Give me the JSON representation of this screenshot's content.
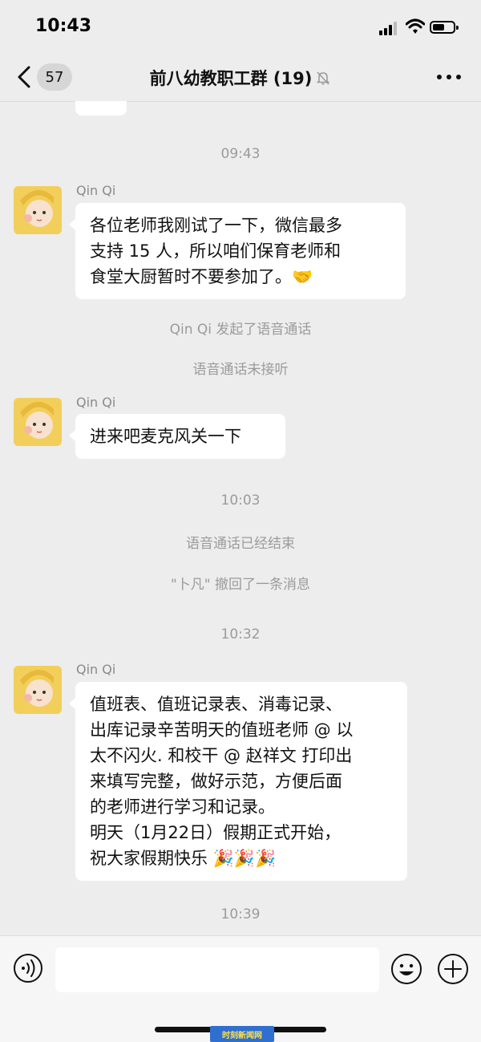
{
  "status_bar": {
    "time": "10:43"
  },
  "nav": {
    "back_count": "57",
    "title": "前八幼教职工群 (19)",
    "mute_icon": "bell-slash-icon",
    "more_icon": "ellipsis-icon"
  },
  "messages": {
    "time_1": "09:43",
    "sender_1": "Qin Qi",
    "bubble_1": [
      "各位老师我刚试了一下，微信最多",
      "支持 15 人，所以咱们保育老师和",
      "食堂大厨暂时不要参加了。🤝"
    ],
    "system_1": "Qin Qi 发起了语音通话",
    "system_2": "语音通话未接听",
    "sender_2": "Qin Qi",
    "bubble_2": "进来吧麦克风关一下",
    "time_2": "10:03",
    "system_3": "语音通话已经结束",
    "system_4": "\"卜凡\" 撤回了一条消息",
    "time_3": "10:32",
    "sender_3": "Qin Qi",
    "bubble_3": [
      "值班表、值班记录表、消毒记录、",
      "出库记录辛苦明天的值班老师 @ 以",
      "太不闪火. 和校干 @ 赵祥文 打印出",
      "来填写完整，做好示范，方便后面",
      "的老师进行学习和记录。",
      "明天（1月22日）假期正式开始，",
      "祝大家假期快乐 🎉🎉🎉"
    ],
    "time_4": "10:39"
  },
  "input_bar": {
    "voice_icon": "voice-icon",
    "emoji_icon": "emoji-icon",
    "plus_icon": "plus-icon",
    "text_value": ""
  },
  "watermark": {
    "text": "时刻新闻网"
  },
  "colors": {
    "background": "#ededed",
    "bubble": "#ffffff",
    "system_text": "#9b9b9b"
  }
}
